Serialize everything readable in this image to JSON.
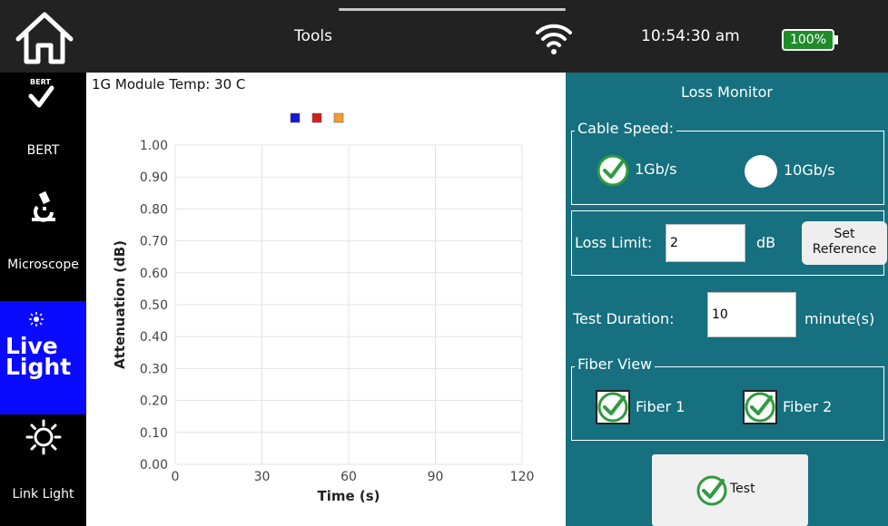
{
  "topbar": {
    "title": "Tools",
    "time": "10:54:30 am",
    "battery": "100%",
    "battery_level": 1.0,
    "icons": [
      "home-icon",
      "wifi-icon",
      "battery-icon"
    ]
  },
  "sidebar": {
    "items": [
      {
        "label": "BERT",
        "badge": "BERT",
        "icon": "bert-check-icon"
      },
      {
        "label": "Microscope",
        "icon": "microscope-icon"
      },
      {
        "label": "Live\nLight",
        "icon": "live-light-icon",
        "selected": true
      },
      {
        "label": "Link Light",
        "icon": "sun-icon"
      }
    ],
    "selected_color": "#0a0aff"
  },
  "chart": {
    "module_temp": "1G Module Temp: 30 C"
  },
  "chart_data": {
    "type": "line",
    "title": "",
    "xlabel": "Time (s)",
    "ylabel": "Attenuation (dB)",
    "x_ticks": [
      "0",
      "30",
      "60",
      "90",
      "120"
    ],
    "y_ticks": [
      "0.00",
      "0.10",
      "0.20",
      "0.30",
      "0.40",
      "0.50",
      "0.60",
      "0.70",
      "0.80",
      "0.90",
      "1.00"
    ],
    "xlim": [
      0,
      120
    ],
    "ylim": [
      0,
      1
    ],
    "grid": true,
    "legend_placement": "top-center",
    "series": [
      {
        "color": "#1717d6",
        "x": [],
        "y": []
      },
      {
        "color": "#d61c1c",
        "x": [],
        "y": []
      },
      {
        "color": "#f29b2e",
        "x": [],
        "y": []
      }
    ]
  },
  "panel": {
    "title": "Loss Monitor",
    "cable_speed": {
      "legend": "Cable Speed:",
      "options": [
        {
          "label": "1Gb/s",
          "selected": true
        },
        {
          "label": "10Gb/s",
          "selected": false
        }
      ]
    },
    "loss_limit": {
      "label": "Loss Limit:",
      "value": "2",
      "unit": "dB",
      "set_reference": "Set\nReference"
    },
    "test_duration": {
      "label": "Test Duration:",
      "value": "10",
      "unit": "minute(s)"
    },
    "fiber_view": {
      "legend": "Fiber View",
      "fibers": [
        {
          "label": "Fiber 1",
          "checked": true
        },
        {
          "label": "Fiber 2",
          "checked": true
        }
      ]
    },
    "test_button": "Test",
    "accent": "#16707f",
    "check_color": "#2f9a3e"
  }
}
